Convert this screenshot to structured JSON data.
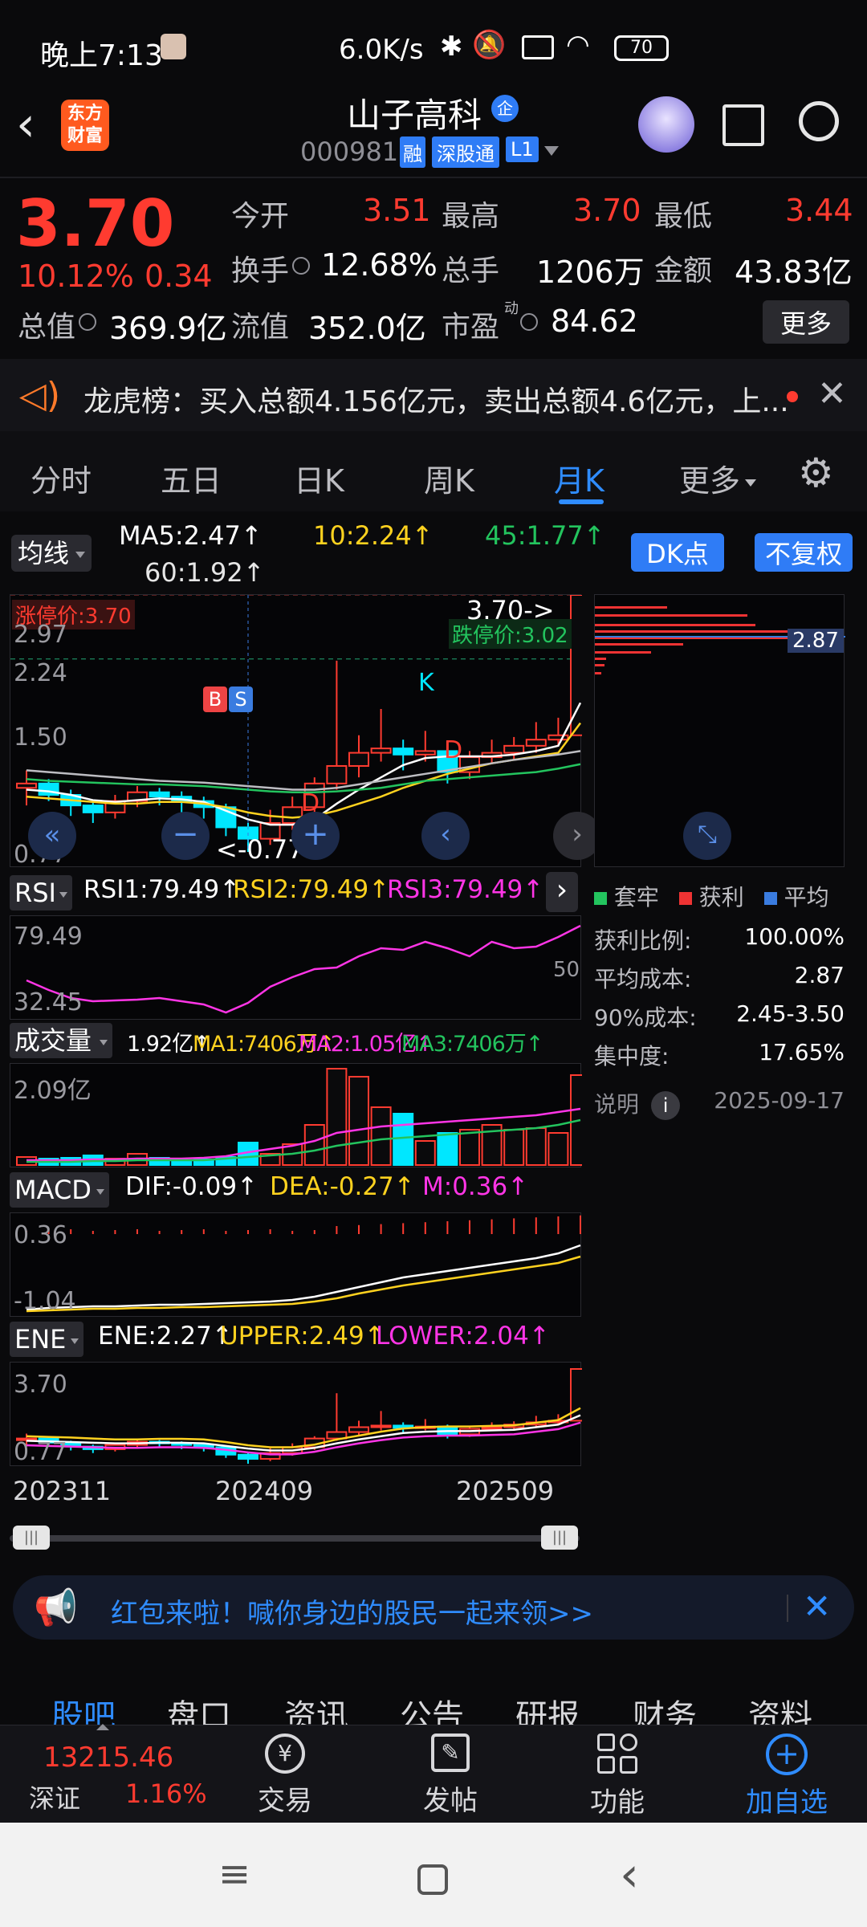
{
  "status_bar": {
    "time": "晚上7:13",
    "net_speed": "6.0K/s",
    "battery": "70"
  },
  "header": {
    "logo_line1": "东方",
    "logo_line2": "财富",
    "stock_name": "山子高科",
    "badge_qi": "企",
    "stock_code": "000981",
    "tag_rong": "融",
    "tag_sgt": "深股通",
    "tag_l1": "L1"
  },
  "quote": {
    "price": "3.70",
    "change_pct": "10.12%",
    "change_amt": "0.34",
    "fields": [
      {
        "label": "今开",
        "value": "3.51"
      },
      {
        "label": "最高",
        "value": "3.70"
      },
      {
        "label": "最低",
        "value": "3.44"
      },
      {
        "label": "换手",
        "value": "12.68%"
      },
      {
        "label": "总手",
        "value": "1206万"
      },
      {
        "label": "金额",
        "value": "43.83亿"
      },
      {
        "label": "总值",
        "value": "369.9亿"
      },
      {
        "label": "流值",
        "value": "352.0亿"
      },
      {
        "label": "市盈",
        "value": "84.62"
      }
    ],
    "more_label": "更多",
    "pe_superscript": "动"
  },
  "notice": {
    "text": "龙虎榜：买入总额4.156亿元，卖出总额4.6亿元，上..."
  },
  "tabs": [
    "分时",
    "五日",
    "日K",
    "周K",
    "月K",
    "更多"
  ],
  "active_tab_index": 4,
  "ma_legend": {
    "selector": "均线",
    "ma5": "MA5:2.47↑",
    "ma10": "10:2.24↑",
    "ma45": "45:1.77↑",
    "ma60": "60:1.92↑",
    "dk_label": "DK点",
    "fq_label": "不复权"
  },
  "kline": {
    "limit_up_label": "涨停价:3.70",
    "limit_down_label": "跌停价:3.02",
    "high_marker": "3.70->",
    "low_marker": "<-0.77",
    "y_labels": [
      "2.97",
      "2.24",
      "1.50",
      "0.77"
    ],
    "marker_b": "B",
    "marker_s": "S",
    "marker_k": "K",
    "marker_d": "D",
    "x_labels": [
      "202311",
      "202409",
      "202509"
    ]
  },
  "chip": {
    "avg_cost_tag": "2.87",
    "legend": [
      "套牢",
      "获利",
      "平均"
    ],
    "rows": [
      {
        "label": "获利比例:",
        "value": "100.00%"
      },
      {
        "label": "平均成本:",
        "value": "2.87"
      },
      {
        "label": "90%成本:",
        "value": "2.45-3.50"
      },
      {
        "label": "集中度:",
        "value": "17.65%"
      }
    ],
    "note_label": "说明",
    "date": "2025-09-17"
  },
  "rsi": {
    "selector": "RSI",
    "rsi1": "RSI1:79.49↑",
    "rsi2": "RSI2:79.49↑",
    "rsi3": "RSI3:79.49↑",
    "top": "79.49",
    "bottom": "32.45",
    "mid": "50"
  },
  "volume": {
    "selector": "成交量",
    "vol": "1.92亿↑",
    "ma1": "MA1:7406万↑",
    "ma2": "MA2:1.05亿↑",
    "ma3": "MA3:7406万↑",
    "top": "2.09亿"
  },
  "macd": {
    "selector": "MACD",
    "dif": "DIF:-0.09↑",
    "dea": "DEA:-0.27↑",
    "m": "M:0.36↑",
    "top": "0.36",
    "bottom": "-1.04"
  },
  "ene": {
    "selector": "ENE",
    "ene": "ENE:2.27↑",
    "upper": "UPPER:2.49↑",
    "lower": "LOWER:2.04↑",
    "top": "3.70",
    "bottom": "0.77"
  },
  "promo": {
    "text": "红包来啦！喊你身边的股民一起来领>>"
  },
  "bottom_tabs": [
    "股吧",
    "盘口",
    "资讯",
    "公告",
    "研报",
    "财务",
    "资料"
  ],
  "bottom_bar": {
    "index_value": "13215.46",
    "index_name": "深证",
    "index_change": "1.16%",
    "trade": "交易",
    "post": "发帖",
    "func": "功能",
    "add": "加自选",
    "trade_symbol": "¥"
  },
  "colors": {
    "up": "#ff3b30",
    "down": "#00e7ff",
    "accent": "#2f7cf6"
  }
}
